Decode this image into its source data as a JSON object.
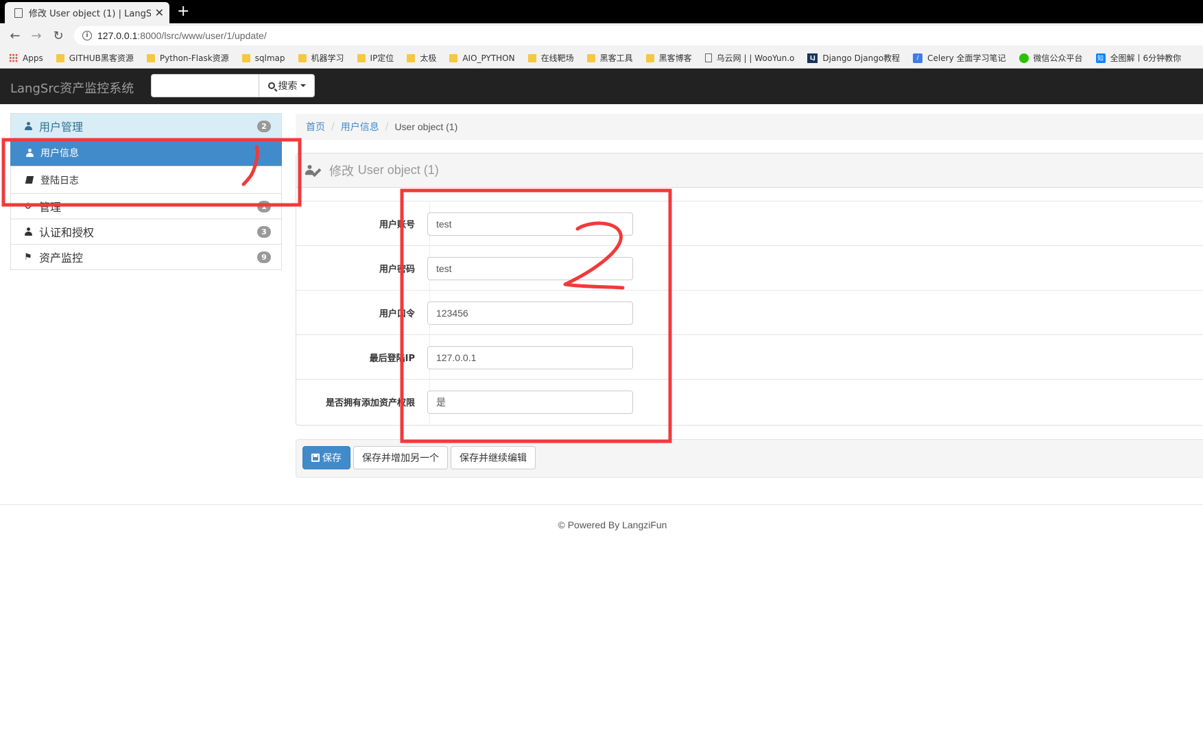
{
  "browser": {
    "tab_title": "修改 User object (1) | LangSrc资",
    "new_tab": "+",
    "url_host": "127.0.0.1",
    "url_path": ":8000/lsrc/www/user/1/update/",
    "bookmarks": [
      {
        "label": "Apps",
        "icon": "apps-icon"
      },
      {
        "label": "GITHUB黑客资源",
        "icon": "folder-icon"
      },
      {
        "label": "Python-Flask资源",
        "icon": "folder-icon"
      },
      {
        "label": "sqlmap",
        "icon": "folder-icon"
      },
      {
        "label": "机器学习",
        "icon": "folder-icon"
      },
      {
        "label": "IP定位",
        "icon": "folder-icon"
      },
      {
        "label": "太极",
        "icon": "folder-icon"
      },
      {
        "label": "AIO_PYTHON",
        "icon": "folder-icon"
      },
      {
        "label": "在线靶场",
        "icon": "folder-icon"
      },
      {
        "label": "黑客工具",
        "icon": "folder-icon"
      },
      {
        "label": "黑客博客",
        "icon": "folder-icon"
      },
      {
        "label": "乌云网 | | WooYun.o",
        "icon": "page-icon"
      },
      {
        "label": "Django Django教程",
        "icon": "lj-icon"
      },
      {
        "label": "Celery 全面学习笔记",
        "icon": "celery-icon"
      },
      {
        "label": "微信公众平台",
        "icon": "wechat-icon"
      },
      {
        "label": "全图解丨6分钟教你",
        "icon": "zhihu-icon"
      }
    ]
  },
  "navbar": {
    "brand": "LangSrc资产监控系统",
    "search_placeholder": "",
    "search_button": "搜索"
  },
  "sidebar": {
    "items": [
      {
        "label": "用户管理",
        "badge": "2",
        "type": "head",
        "icon": "user-icon"
      },
      {
        "label": "用户信息",
        "type": "sub-active",
        "icon": "user-icon"
      },
      {
        "label": "登陆日志",
        "type": "sub",
        "icon": "book-icon"
      },
      {
        "label": "管理",
        "badge": "1",
        "type": "group",
        "icon": "gear-icon"
      },
      {
        "label": "认证和授权",
        "badge": "3",
        "type": "group",
        "icon": "users-icon"
      },
      {
        "label": "资产监控",
        "badge": "9",
        "type": "group",
        "icon": "flag-icon"
      }
    ]
  },
  "breadcrumb": {
    "home": "首页",
    "section": "用户信息",
    "current": "User object (1)",
    "separator": "/"
  },
  "panel": {
    "title_prefix": "修改 ",
    "title_object": "User object (1)"
  },
  "form": {
    "fields": [
      {
        "label": "用户账号",
        "value": "test"
      },
      {
        "label": "用户密码",
        "value": "test"
      },
      {
        "label": "用户口令",
        "value": "123456"
      },
      {
        "label": "最后登陆IP",
        "value": "127.0.0.1"
      },
      {
        "label": "是否拥有添加资产权限",
        "value": "是"
      }
    ]
  },
  "actions": {
    "save": "保存",
    "save_add_another": "保存并增加另一个",
    "save_continue": "保存并继续编辑"
  },
  "footer": {
    "text": "© Powered By LangziFun"
  },
  "annotations": {
    "label_1": "1",
    "label_2": "2",
    "color": "#f03a3a"
  }
}
